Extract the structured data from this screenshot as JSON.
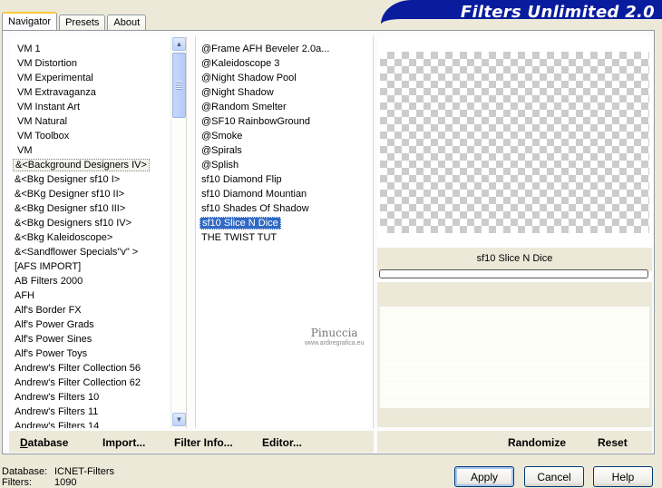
{
  "app": {
    "title": "Filters Unlimited 2.0"
  },
  "tabs": [
    {
      "label": "Navigator",
      "active": true
    },
    {
      "label": "Presets",
      "active": false
    },
    {
      "label": "About",
      "active": false
    }
  ],
  "categories": [
    "VM 1",
    "VM Distortion",
    "VM Experimental",
    "VM Extravaganza",
    "VM Instant Art",
    "VM Natural",
    "VM Toolbox",
    "VM",
    "&<Background Designers IV>",
    "&<Bkg Designer sf10 I>",
    "&<BKg Designer sf10 II>",
    "&<Bkg Designer sf10 III>",
    "&<Bkg Designers sf10 IV>",
    "&<Bkg Kaleidoscope>",
    "&<Sandflower Specials\"v\" >",
    "[AFS IMPORT]",
    "AB Filters 2000",
    "AFH",
    "Alf's Border FX",
    "Alf's Power Grads",
    "Alf's Power Sines",
    "Alf's Power Toys",
    "Andrew's Filter Collection 56",
    "Andrew's Filter Collection 62",
    "Andrew's Filters 10",
    "Andrew's Filters 11",
    "Andrew's Filters 14"
  ],
  "selected_category": "&<Background Designers IV>",
  "filters": [
    "@Frame AFH Beveler 2.0a...",
    "@Kaleidoscope 3",
    "@Night Shadow Pool",
    "@Night Shadow",
    "@Random Smelter",
    "@SF10 RainbowGround",
    "@Smoke",
    "@Spirals",
    "@Splish",
    "sf10 Diamond Flip",
    "sf10 Diamond Mountian",
    "sf10 Shades Of Shadow",
    "sf10 Slice N Dice",
    "THE TWIST TUT"
  ],
  "selected_filter": "sf10 Slice N Dice",
  "preview": {
    "filter_name": "sf10 Slice N Dice"
  },
  "watermark": {
    "name": "Pinuccia",
    "site": "www.ardiregrafica.eu"
  },
  "toolbar": {
    "database": "Database",
    "import": "Import...",
    "filter_info": "Filter Info...",
    "editor": "Editor...",
    "randomize": "Randomize",
    "reset": "Reset"
  },
  "status": {
    "database_label": "Database:",
    "database_value": "ICNET-Filters",
    "filters_label": "Filters:",
    "filters_value": "1090"
  },
  "buttons": {
    "apply": "Apply",
    "cancel": "Cancel",
    "help": "Help"
  }
}
